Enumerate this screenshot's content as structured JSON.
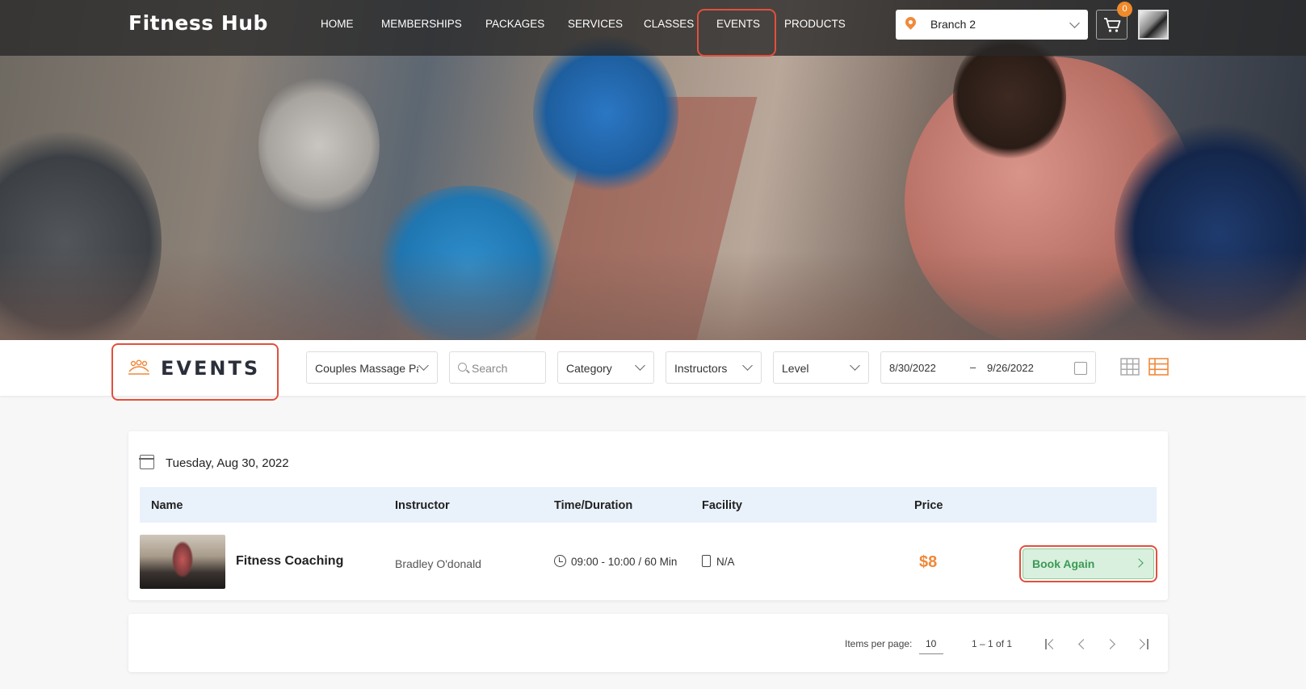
{
  "app": {
    "brand": "Fitness Hub"
  },
  "nav": {
    "items": [
      {
        "label": "HOME"
      },
      {
        "label": "MEMBERSHIPS"
      },
      {
        "label": "PACKAGES"
      },
      {
        "label": "SERVICES"
      },
      {
        "label": "CLASSES"
      },
      {
        "label": "EVENTS",
        "active": true
      },
      {
        "label": "PRODUCTS"
      }
    ]
  },
  "branch": {
    "selected": "Branch 2",
    "icon": "location-pin-icon"
  },
  "cart": {
    "count": "0",
    "icon": "cart-icon"
  },
  "page": {
    "title": "EVENTS",
    "icon": "people-group-icon"
  },
  "filters": {
    "event_select": "Couples Massage Pa",
    "search_placeholder": "Search",
    "category": "Category",
    "instructors": "Instructors",
    "level": "Level",
    "date_from": "8/30/2022",
    "date_separator": "–",
    "date_to": "9/26/2022"
  },
  "schedule": {
    "date_label": "Tuesday, Aug 30, 2022",
    "columns": [
      "Name",
      "Instructor",
      "Time/Duration",
      "Facility",
      "Price"
    ],
    "rows": [
      {
        "name": "Fitness Coaching",
        "instructor": "Bradley O'donald",
        "time": "09:00 - 10:00 / 60 Min",
        "facility": "N/A",
        "price": "$8",
        "action": "Book Again"
      }
    ]
  },
  "pagination": {
    "items_per_page_label": "Items per page:",
    "items_per_page": "10",
    "range": "1 – 1 of 1"
  },
  "colors": {
    "accent": "#f0883a",
    "highlight": "#e2503c",
    "book_button_bg": "#d9f0de",
    "book_button_text": "#3a9a55",
    "table_header_bg": "#e9f1fb"
  }
}
